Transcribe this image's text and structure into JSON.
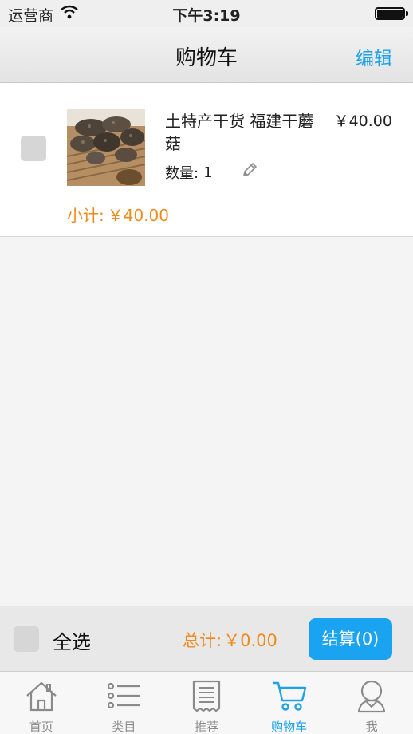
{
  "status_bar": {
    "carrier": "运营商",
    "time": "下午3:19"
  },
  "nav": {
    "title": "购物车",
    "edit_label": "编辑"
  },
  "cart": {
    "items": [
      {
        "name": "土特产干货 福建干蘑菇",
        "price": "￥40.00",
        "quantity_label": "数量:",
        "quantity": "1",
        "subtotal_label": "小计:",
        "subtotal": "￥40.00",
        "checked": false
      }
    ]
  },
  "footer": {
    "select_all_label": "全选",
    "total_label": "总计:",
    "total_value": "￥0.00",
    "checkout_label": "结算(0)"
  },
  "tabs": [
    {
      "label": "首页",
      "icon": "home-icon",
      "active": false
    },
    {
      "label": "类目",
      "icon": "list-icon",
      "active": false
    },
    {
      "label": "推荐",
      "icon": "receipt-icon",
      "active": false
    },
    {
      "label": "购物车",
      "icon": "cart-icon",
      "active": true
    },
    {
      "label": "我",
      "icon": "user-icon",
      "active": false
    }
  ],
  "colors": {
    "accent": "#1ea3ea",
    "price_orange": "#f08a1c",
    "checkout_button": "#1aa3f0"
  }
}
